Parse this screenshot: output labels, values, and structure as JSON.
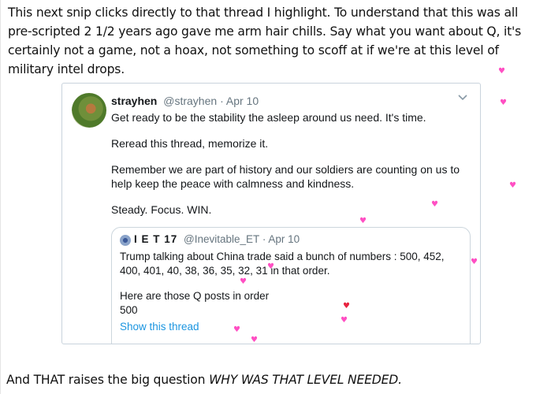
{
  "intro_text": "This next snip clicks directly to that thread I highlight. To understand that this was all pre-scripted 2 1/2 years ago gave me arm hair chills. Say what you want about Q, it's certainly not a game, not a hoax, not something to scoff at if we're at this level of military intel drops.",
  "tweet": {
    "display_name": "strayhen",
    "handle": "@strayhen",
    "separator": "·",
    "date": "Apr 10",
    "paragraphs": [
      "Get ready to be the stability the asleep around us need. It's time.",
      "Reread this thread, memorize it.",
      "Remember we are part of history and our soldiers are counting on us to help keep the peace with calmness and kindness.",
      "Steady. Focus. WIN."
    ],
    "quote": {
      "display_name": "I E T 17",
      "handle": "@Inevitable_ET",
      "separator": "·",
      "date": "Apr 10",
      "line1": "Trump talking about China trade said a bunch of numbers : 500, 452, 400, 401, 40, 38, 36, 35, 32, 31 in that order.",
      "line2": "Here are those Q posts in order",
      "line3": "500",
      "show_thread_label": "Show this thread"
    }
  },
  "outro": {
    "prefix": "And THAT raises the big question",
    "emphasis": "WHY WAS THAT LEVEL NEEDED."
  },
  "colors": {
    "heart_pink": "#ff4fc3",
    "heart_red": "#e8233f",
    "link_blue": "#1b95e0"
  },
  "hearts_glyph": "♥"
}
